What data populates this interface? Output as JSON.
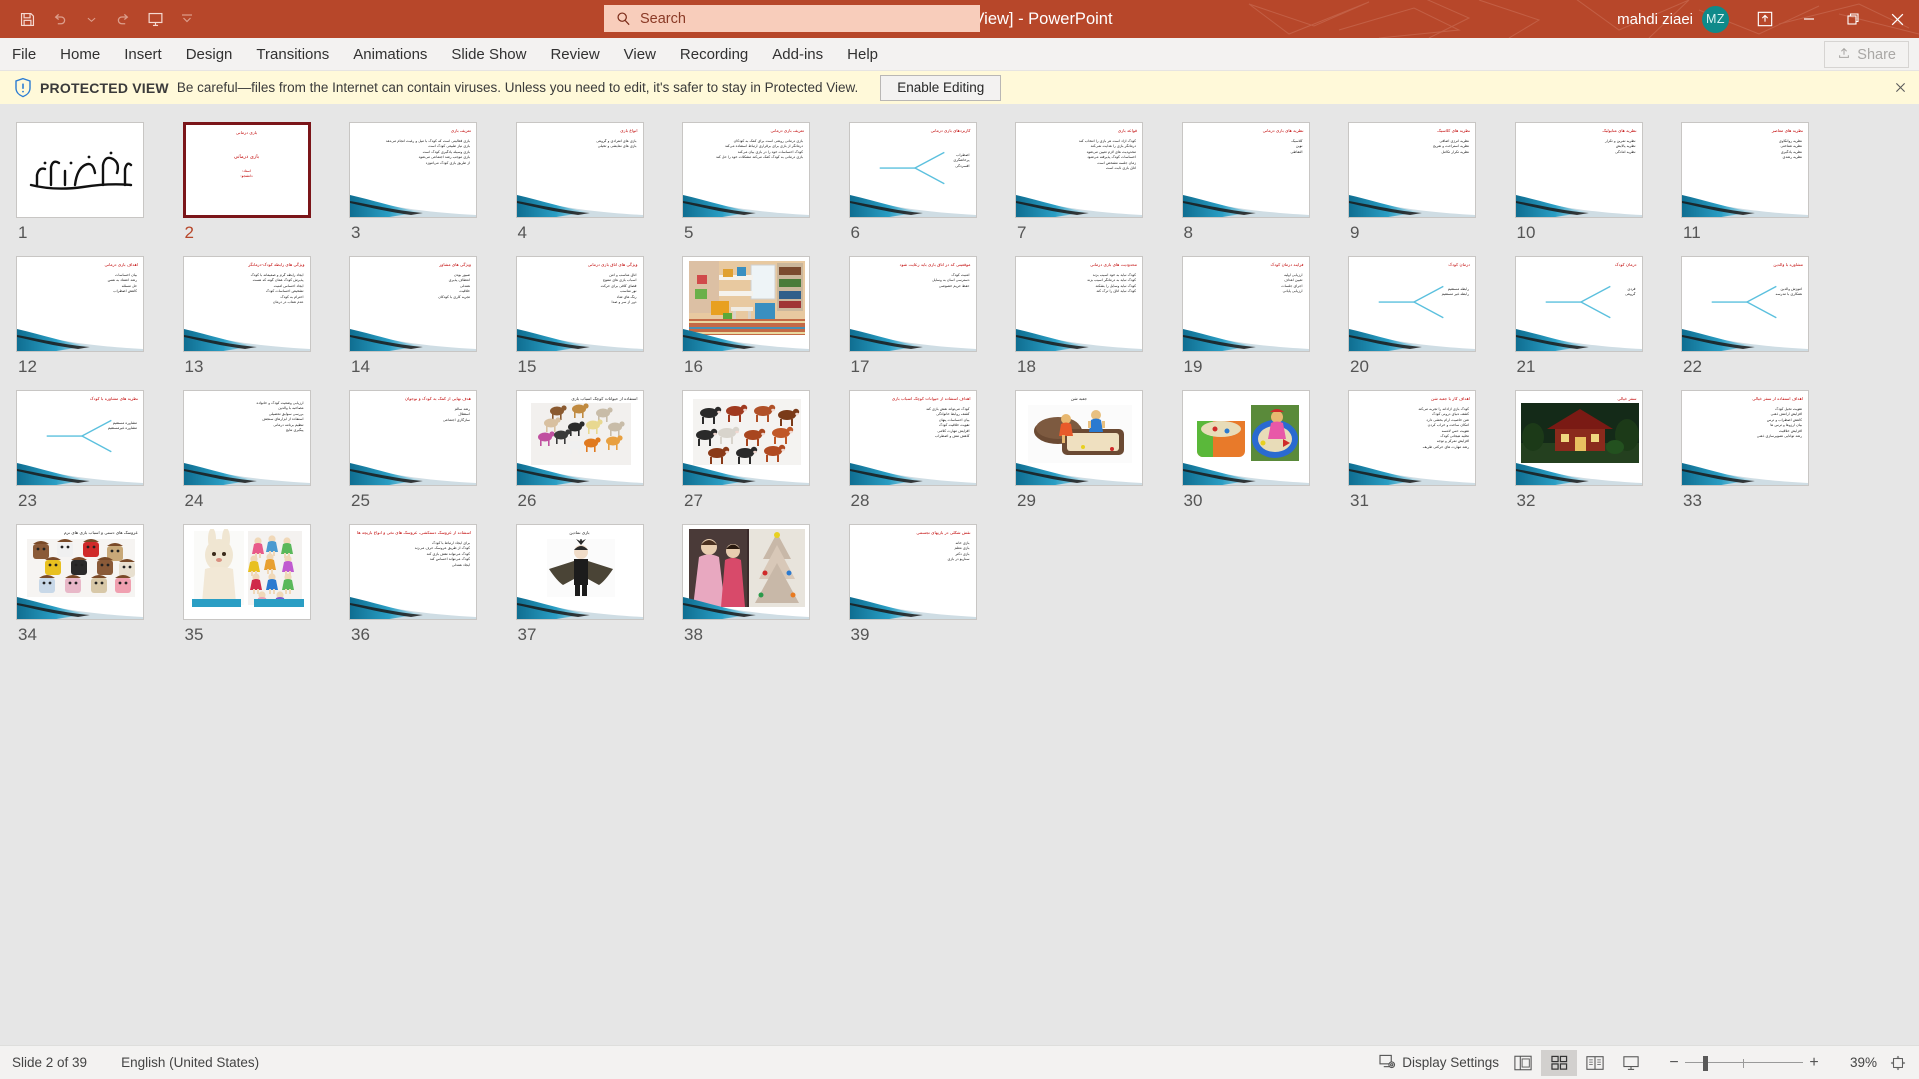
{
  "titlebar": {
    "document_title": "بازی درمانی [Protected View]  -  PowerPoint",
    "quick_access": [
      {
        "name": "save-icon",
        "label": "Save"
      },
      {
        "name": "undo-icon",
        "label": "Undo"
      },
      {
        "name": "undo-dropdown-icon",
        "label": "Undo options"
      },
      {
        "name": "redo-icon",
        "label": "Redo"
      },
      {
        "name": "start-presentation-icon",
        "label": "Start From Beginning"
      },
      {
        "name": "customize-qat-icon",
        "label": "Customize Quick Access Toolbar"
      }
    ],
    "user_name": "mahdi ziaei",
    "user_initials": "MZ",
    "window_buttons": [
      {
        "name": "ribbon-display-options-icon",
        "label": "Ribbon Display Options"
      },
      {
        "name": "minimize-icon",
        "label": "Minimize"
      },
      {
        "name": "restore-icon",
        "label": "Restore Down"
      },
      {
        "name": "close-icon",
        "label": "Close"
      }
    ],
    "accent_color": "#b7472a"
  },
  "search": {
    "placeholder": "Search",
    "value": "",
    "icon": "search-icon"
  },
  "ribbon": {
    "tabs": [
      "File",
      "Home",
      "Insert",
      "Design",
      "Transitions",
      "Animations",
      "Slide Show",
      "Review",
      "View",
      "Recording",
      "Add-ins",
      "Help"
    ],
    "share_label": "Share",
    "share_icon": "share-icon"
  },
  "protected_view": {
    "icon": "shield-icon",
    "badge": "PROTECTED VIEW",
    "message": "Be careful—files from the Internet can contain viruses. Unless you need to edit, it's safer to stay in Protected View.",
    "enable_button": "Enable Editing",
    "close_icon": "close-icon",
    "background": "#fff9d9"
  },
  "slide_sorter": {
    "selected_slide": 2,
    "selection_color": "#7b1519",
    "slides": [
      {
        "n": "1",
        "kind": "calligraphy",
        "title": "",
        "lines": []
      },
      {
        "n": "2",
        "kind": "title",
        "title": "بازی درمانی",
        "lines": [
          "استاد:",
          "دانشجو:"
        ],
        "no_swoosh": true
      },
      {
        "n": "3",
        "kind": "text",
        "title": "تعریف بازی",
        "lines": [
          "بازی فعالیتی است که کودک با میل و رغبت انجام می‌دهد",
          "بازی نیاز طبیعی کودک است",
          "بازی وسیله یادگیری کودک است",
          "بازی موجب رشد اجتماعی می‌شود",
          "از طریق بازی کودک می‌آموزد"
        ]
      },
      {
        "n": "4",
        "kind": "text",
        "title": "انواع بازی",
        "lines": [
          "بازی های انفرادی و گروهی",
          "بازی های نمایشی و تخیلی"
        ]
      },
      {
        "n": "5",
        "kind": "text",
        "title": "تعریف بازی درمانی",
        "lines": [
          "بازی درمانی روشی است برای کمک به کودکان",
          "درمانگر از بازی برای برقراری ارتباط استفاده می‌کند",
          "کودک احساسات خود را در بازی بیان می‌کند",
          "بازی درمانی به کودک کمک می‌کند مشکلات خود را حل کند"
        ]
      },
      {
        "n": "6",
        "kind": "diagram",
        "title": "کاربردهای بازی درمانی",
        "lines": [
          "اضطراب",
          "پرخاشگری",
          "افسردگی"
        ]
      },
      {
        "n": "7",
        "kind": "text",
        "title": "قواعد بازی",
        "lines": [
          "کودک آزاد است هر بازی را انتخاب کند",
          "درمانگر بازی را هدایت نمی‌کند",
          "محدودیت های لازم تعیین می‌شود",
          "احساسات کودک پذیرفته می‌شود",
          "زمان جلسه مشخص است",
          "اتاق بازی ثابت است"
        ]
      },
      {
        "n": "8",
        "kind": "text",
        "title": "نظریه های بازی درمانی",
        "lines": [
          "کلاسیک",
          "نوین",
          "التقاطی"
        ]
      },
      {
        "n": "9",
        "kind": "text",
        "title": "نظریه های کلاسیک",
        "lines": [
          "نظریه انرژی اضافی",
          "نظریه استراحت و تفریح",
          "نظریه تکرار تکامل"
        ]
      },
      {
        "n": "10",
        "kind": "text",
        "title": "نظریه های متابولیک",
        "lines": [
          "نظریه تمرین و تکرار",
          "نظریه پالایش",
          "نظریه آمادگی"
        ]
      },
      {
        "n": "11",
        "kind": "text",
        "title": "نظریه های معاصر",
        "lines": [
          "نظریه روانکاوی",
          "نظریه شناختی",
          "نظریه یادگیری",
          "نظریه رشدی"
        ]
      },
      {
        "n": "12",
        "kind": "text",
        "title": "اهداف بازی درمانی",
        "lines": [
          "بیان احساسات",
          "رشد اعتماد به نفس",
          "حل مسئله",
          "کاهش اضطراب"
        ]
      },
      {
        "n": "13",
        "kind": "text",
        "title": "ویژگی های رابطه کودک-درمانگر",
        "lines": [
          "ایجاد رابطه گرم و صمیمانه با کودک",
          "پذیرش کودک همان گونه که هست",
          "ایجاد احساس امنیت",
          "تشخیص احساسات کودک",
          "احترام به کودک",
          "عدم شتاب در درمان"
        ]
      },
      {
        "n": "14",
        "kind": "text",
        "title": "ویژگی های مشاور",
        "lines": [
          "صبور بودن",
          "انعطاف پذیری",
          "همدلی",
          "خلاقیت",
          "تجربه کاری با کودکان"
        ]
      },
      {
        "n": "15",
        "kind": "text",
        "title": "ویژگی های اتاق بازی درمانی",
        "lines": [
          "اتاق مناسب و امن",
          "اسباب بازی های متنوع",
          "فضای کافی برای حرکت",
          "نور مناسب",
          "رنگ های شاد",
          "دور از سر و صدا"
        ]
      },
      {
        "n": "16",
        "kind": "photo-room",
        "title": "",
        "lines": []
      },
      {
        "n": "17",
        "kind": "text",
        "title": "موقعیتی که در اتاق بازی باید رعایت شود",
        "lines": [
          "امنیت کودک",
          "دسترسی آسان به وسایل",
          "حفظ حریم خصوصی"
        ]
      },
      {
        "n": "18",
        "kind": "text",
        "title": "محدودیت های بازی درمانی",
        "lines": [
          "کودک نباید به خود آسیب بزند",
          "کودک نباید به درمانگر آسیب بزند",
          "کودک نباید وسایل را بشکند",
          "کودک نباید اتاق را ترک کند"
        ]
      },
      {
        "n": "19",
        "kind": "text",
        "title": "فرایند درمان کودک",
        "lines": [
          "ارزیابی اولیه",
          "تعیین اهداف",
          "اجرای جلسات",
          "ارزیابی پایانی"
        ]
      },
      {
        "n": "20",
        "kind": "diagram",
        "title": "درمان کودک",
        "lines": [
          "رابطه مستقیم",
          "رابطه غیر مستقیم"
        ]
      },
      {
        "n": "21",
        "kind": "diagram",
        "title": "درمان کودک",
        "lines": [
          "فردی",
          "گروهی"
        ]
      },
      {
        "n": "22",
        "kind": "diagram",
        "title": "مشاوره با والدین",
        "lines": [
          "آموزش والدین",
          "همکاری با مدرسه"
        ]
      },
      {
        "n": "23",
        "kind": "diagram",
        "title": "نظریه های مشاوره با کودک",
        "lines": [
          "مشاوره مستقیم",
          "مشاوره غیرمستقیم"
        ]
      },
      {
        "n": "24",
        "kind": "text",
        "title": "",
        "lines": [
          "ارزیابی وضعیت کودک و خانواده",
          "مصاحبه با والدین",
          "بررسی سوابق تحصیلی",
          "استفاده از ابزارهای سنجش",
          "تنظیم برنامه درمانی",
          "پیگیری نتایج"
        ]
      },
      {
        "n": "25",
        "kind": "text",
        "title": "هدف نهایی از کمک به کودک و نوجوان",
        "lines": [
          "رشد سالم",
          "استقلال",
          "سازگاری اجتماعی"
        ]
      },
      {
        "n": "26",
        "kind": "photo-animals",
        "title": "استفاده از حیوانات کوچک اسباب بازی",
        "lines": []
      },
      {
        "n": "27",
        "kind": "photo-cows",
        "title": "",
        "lines": []
      },
      {
        "n": "28",
        "kind": "text",
        "title": "اهداف استفاده از حیوانات کوچک اسباب بازی",
        "lines": [
          "کودک می‌تواند نقش بازی کند",
          "کشف روابط خانوادگی",
          "بیان احساسات پنهان",
          "تقویت خلاقیت کودک",
          "افزایش مهارت کلامی",
          "کاهش تنش و اضطراب"
        ]
      },
      {
        "n": "29",
        "kind": "photo-sandbox",
        "title": "جعبه شن",
        "lines": []
      },
      {
        "n": "30",
        "kind": "photo-sandtable",
        "title": "",
        "lines": []
      },
      {
        "n": "31",
        "kind": "text",
        "title": "اهداف کار با جعبه شن",
        "lines": [
          "کودک بازی آزادانه را تجربه می‌کند",
          "کشف دنیای درونی کودک",
          "شن خاصیت آرام بخشی دارد",
          "امکان ساخت و خراب کردن",
          "تقویت حس لامسه",
          "تخلیه هیجانی کودک",
          "افزایش تمرکز و توجه",
          "رشد مهارت های حرکتی ظریف"
        ]
      },
      {
        "n": "32",
        "kind": "photo-house",
        "title": "سفر خیالی",
        "lines": []
      },
      {
        "n": "33",
        "kind": "text",
        "title": "اهداف استفاده از سفر خیالی",
        "lines": [
          "تقویت تخیل کودک",
          "افزایش آرامش ذهنی",
          "کاهش اضطراب و ترس",
          "بیان آرزوها و ترس ها",
          "افزایش خلاقیت",
          "رشد توانایی تصویرسازی ذهنی"
        ]
      },
      {
        "n": "34",
        "kind": "photo-puppets",
        "title": "عروسک های دستی و اسباب بازی های نرم",
        "lines": []
      },
      {
        "n": "35",
        "kind": "photo-dolls",
        "title": "",
        "lines": []
      },
      {
        "n": "36",
        "kind": "text",
        "title": "استفاده از عروسک دستکشی، عروسک های نخی و انواع بازیچه ها",
        "lines": [
          "برای ایجاد ارتباط با کودک",
          "کودک از طریق عروسک حرف می‌زند",
          "کودک می‌تواند نقش بازی کند",
          "کودک می‌تواند احساس کند",
          "ایجاد همدلی"
        ]
      },
      {
        "n": "37",
        "kind": "photo-costume",
        "title": "بازی نمادین",
        "lines": []
      },
      {
        "n": "38",
        "kind": "photo-costumes2",
        "title": "",
        "lines": []
      },
      {
        "n": "39",
        "kind": "text",
        "title": "نقش شکلی در بازیهای تجسمی",
        "lines": [
          "بازی خانه",
          "بازی معلم",
          "بازی دکتر",
          "سناریو در بازی"
        ]
      }
    ]
  },
  "statusbar": {
    "slide_indicator": "Slide 2 of 39",
    "language": "English (United States)",
    "display_settings": "Display Settings",
    "display_settings_icon": "display-settings-icon",
    "views": [
      {
        "name": "view-normal",
        "label": "Normal",
        "active": false
      },
      {
        "name": "view-slide-sorter",
        "label": "Slide Sorter",
        "active": true
      },
      {
        "name": "view-reading",
        "label": "Reading View",
        "active": false
      },
      {
        "name": "view-slide-show",
        "label": "Slide Show",
        "active": false
      }
    ],
    "zoom_out_label": "−",
    "zoom_in_label": "+",
    "zoom_level": "39%",
    "fit_icon": "fit-to-window-icon"
  }
}
